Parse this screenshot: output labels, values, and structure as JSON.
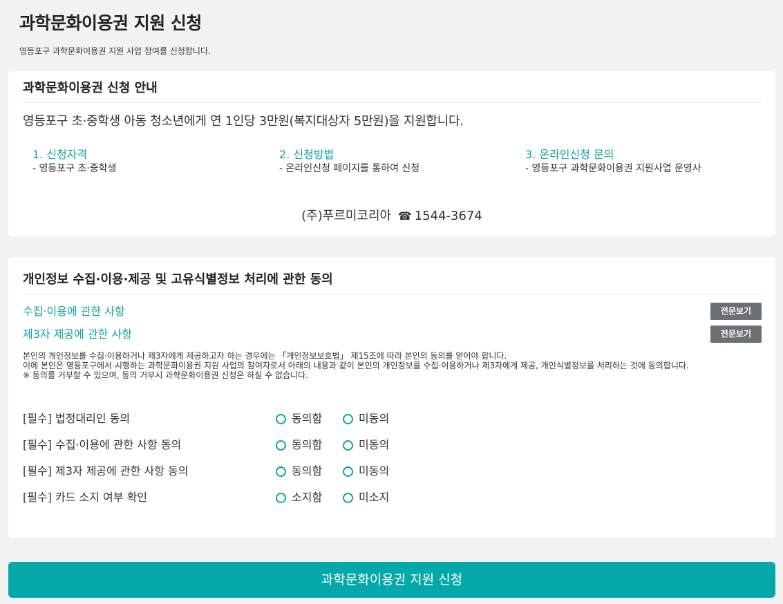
{
  "header": {
    "title": "과학문화이용권 지원 신청",
    "description": "영등포구 과학문화이용권 지원 사업 참여를 신청합니다."
  },
  "guide": {
    "title": "과학문화이용권 신청 안내",
    "intro": "영등포구 초·중학생 아동 청소년에게 연 1인당 3만원(복지대상자 5만원)을 지원합니다.",
    "steps": [
      {
        "title": "1. 신청자격",
        "desc": "- 영등포구 초·중학생"
      },
      {
        "title": "2. 신청방법",
        "desc": "- 온라인신청 페이지를 통하여 신청"
      },
      {
        "title": "3. 온라인신청 문의",
        "desc": "- 영등포구 과학문화이용권 지원사업 운영사"
      }
    ],
    "contact_company": "(주)푸르미코리아",
    "contact_icon": "☎",
    "contact_phone": "1544-3674"
  },
  "consent": {
    "title": "개인정보 수집·이용·제공 및 고유식별정보 처리에 관한 동의",
    "links": [
      {
        "label": "수집·이용에 관한 사항",
        "button": "전문보기"
      },
      {
        "label": "제3자 제공에 관한 사항",
        "button": "전문보기"
      }
    ],
    "notice_lines": [
      "본인의 개인정보를 수집·이용하거나 제3자에게 제공하고자 하는 경우에는 「개인정보보호법」 제15조에 따라 본인의 동의를 얻어야 합니다.",
      "이에 본인은 영등포구에서 시행하는 과학문화이용권 지원 사업의 참여자로서 아래의 내용과 같이 본인의 개인정보를 수집·이용하거나 제3자에게 제공, 개인식별정보를 처리하는 것에 동의합니다.",
      "※ 동의를 거부할 수 있으며, 동의 거부시 과학문화이용권 신청은 하실 수 없습니다."
    ],
    "agreements": [
      {
        "label": "[필수] 법정대리인 동의",
        "yes": "동의함",
        "no": "미동의"
      },
      {
        "label": "[필수] 수집·이용에 관한 사항 동의",
        "yes": "동의함",
        "no": "미동의"
      },
      {
        "label": "[필수] 제3자 제공에 관한 사항 동의",
        "yes": "동의함",
        "no": "미동의"
      },
      {
        "label": "[필수] 카드 소지 여부 확인",
        "yes": "소지함",
        "no": "미소지"
      }
    ]
  },
  "submit_label": "과학문화이용권 지원 신청",
  "colors": {
    "accent": "#05a8a8",
    "button_gray": "#6c7075"
  }
}
